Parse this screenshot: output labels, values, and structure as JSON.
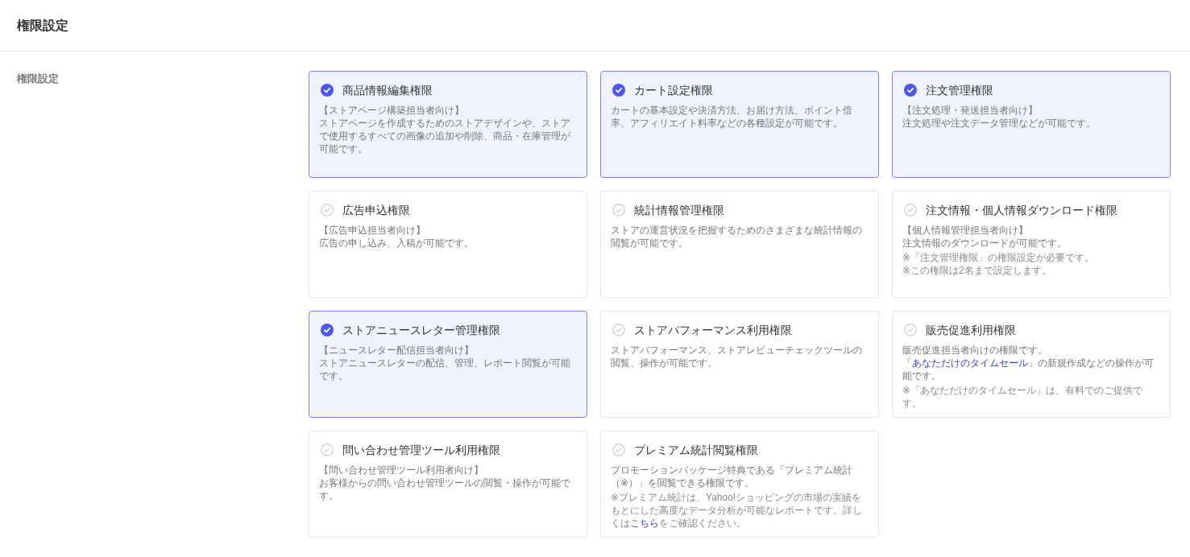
{
  "page": {
    "title": "権限設定"
  },
  "section": {
    "label": "権限設定",
    "permissions": [
      {
        "title": "商品情報編集権限",
        "checked": true,
        "paragraphs": [
          {
            "kind": "body",
            "text": "【ストアページ構築担当者向け】"
          },
          {
            "kind": "body",
            "text": "ストアページを作成するためのストアデザインや、ストアで使用するすべての画像の追加や削除、商品・在庫管理が可能です。"
          }
        ]
      },
      {
        "title": "カート設定権限",
        "checked": true,
        "paragraphs": [
          {
            "kind": "body",
            "text": "カートの基本設定や決済方法、お届け方法、ポイント倍率、アフィリエイト料率などの各種設定が可能です。"
          }
        ]
      },
      {
        "title": "注文管理権限",
        "checked": true,
        "paragraphs": [
          {
            "kind": "body",
            "text": "【注文処理・発送担当者向け】"
          },
          {
            "kind": "body",
            "text": "注文処理や注文データ管理などが可能です。"
          }
        ]
      },
      {
        "title": "広告申込権限",
        "checked": false,
        "paragraphs": [
          {
            "kind": "body",
            "text": "【広告申込担当者向け】"
          },
          {
            "kind": "body",
            "text": "広告の申し込み、入稿が可能です。"
          }
        ]
      },
      {
        "title": "統計情報管理権限",
        "checked": false,
        "paragraphs": [
          {
            "kind": "body",
            "text": "ストアの運営状況を把握するためのさまざまな統計情報の閲覧が可能です。"
          }
        ]
      },
      {
        "title": "注文情報・個人情報ダウンロード権限",
        "checked": false,
        "paragraphs": [
          {
            "kind": "body",
            "text": "【個人情報管理担当者向け】"
          },
          {
            "kind": "body",
            "text": "注文情報のダウンロードが可能です。"
          },
          {
            "kind": "note",
            "text": "※「注文管理権限」の権限設定が必要です。"
          },
          {
            "kind": "note",
            "text": "※この権限は2名まで設定します。"
          }
        ]
      },
      {
        "title": "ストアニュースレター管理権限",
        "checked": true,
        "paragraphs": [
          {
            "kind": "body",
            "text": "【ニュースレター配信担当者向け】"
          },
          {
            "kind": "body",
            "text": "ストアニュースレターの配信、管理、レポート閲覧が可能です。"
          }
        ]
      },
      {
        "title": "ストアパフォーマンス利用権限",
        "checked": false,
        "paragraphs": [
          {
            "kind": "body",
            "text": "ストアパフォーマンス、ストアレビューチェックツールの閲覧、操作が可能です。"
          }
        ]
      },
      {
        "title": "販売促進利用権限",
        "checked": false,
        "paragraphs": [
          {
            "kind": "body",
            "text": "販売促進担当者向けの権限です。"
          },
          {
            "kind": "body",
            "parts": [
              {
                "kind": "text",
                "text": "「"
              },
              {
                "kind": "link",
                "text": "あなただけのタイムセール"
              },
              {
                "kind": "text",
                "text": "」の新規作成などの操作が可能です。"
              }
            ]
          },
          {
            "kind": "note",
            "text": "※「あなただけのタイムセール」は、有料でのご提供です。"
          }
        ]
      },
      {
        "title": "問い合わせ管理ツール利用権限",
        "checked": false,
        "paragraphs": [
          {
            "kind": "body",
            "text": "【問い合わせ管理ツール利用者向け】"
          },
          {
            "kind": "body",
            "text": "お客様からの問い合わせ管理ツールの閲覧・操作が可能です。"
          }
        ]
      },
      {
        "title": "プレミアム統計閲覧権限",
        "checked": false,
        "paragraphs": [
          {
            "kind": "body",
            "text": "プロモーションパッケージ特典である「プレミアム統計（※）」を閲覧できる権限です。"
          },
          {
            "kind": "note",
            "parts": [
              {
                "kind": "text",
                "text": "※プレミアム統計は、Yahoo!ショッピングの市場の実績をもとにした高度なデータ分析が可能なレポートです。詳しくは"
              },
              {
                "kind": "link",
                "text": "こちら"
              },
              {
                "kind": "text",
                "text": "をご確認ください。"
              }
            ]
          }
        ]
      }
    ]
  }
}
